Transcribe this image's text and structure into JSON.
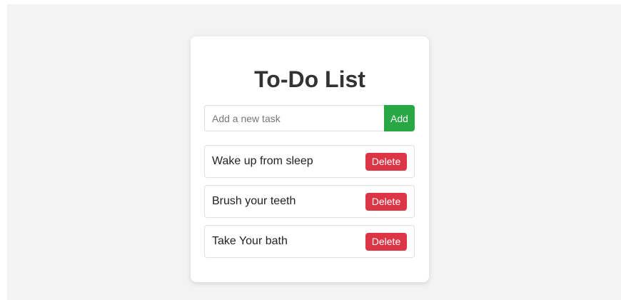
{
  "app": {
    "title": "To-Do List"
  },
  "new_task": {
    "placeholder": "Add a new task",
    "value": "",
    "add_label": "Add"
  },
  "tasks": [
    {
      "text": "Wake up from sleep",
      "delete_label": "Delete"
    },
    {
      "text": "Brush your teeth",
      "delete_label": "Delete"
    },
    {
      "text": "Take Your bath",
      "delete_label": "Delete"
    }
  ],
  "colors": {
    "add_button": "#28a745",
    "delete_button": "#dc3545",
    "background": "#f3f3f3",
    "card": "#ffffff"
  }
}
